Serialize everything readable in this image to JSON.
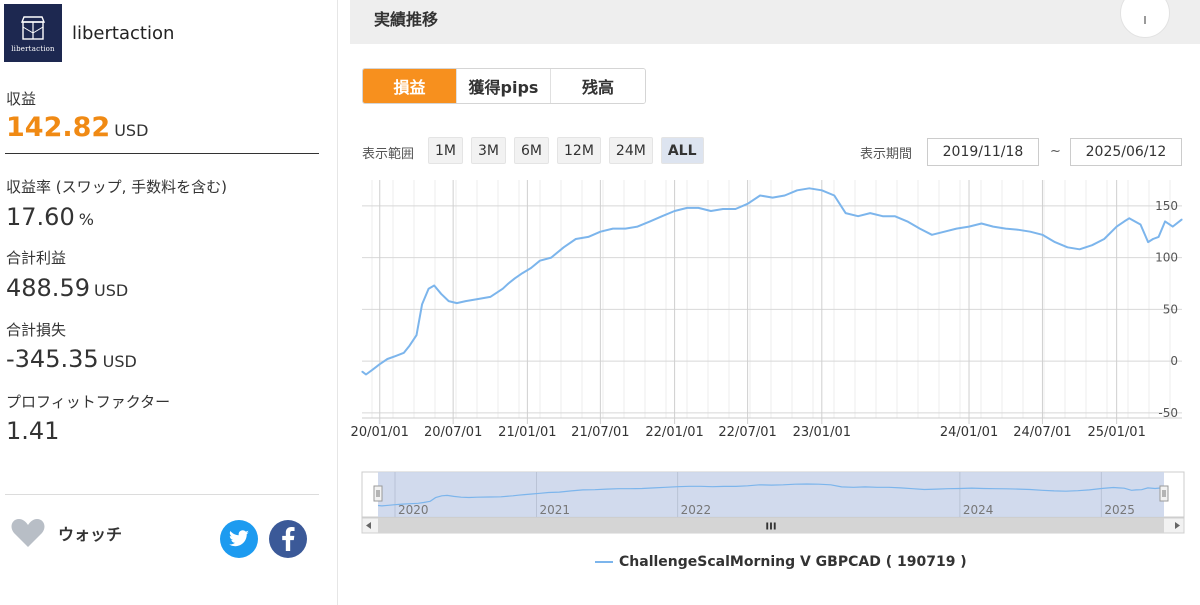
{
  "profile": {
    "name": "libertaction",
    "logo_caption": "libertaction"
  },
  "stats": {
    "profit_label": "収益",
    "profit_value": "142.82",
    "profit_unit": "USD",
    "rate_label": "収益率 (スワップ, 手数料を含む)",
    "rate_value": "17.60",
    "rate_unit": "%",
    "gross_profit_label": "合計利益",
    "gross_profit_value": "488.59",
    "gross_profit_unit": "USD",
    "gross_loss_label": "合計損失",
    "gross_loss_value": "-345.35",
    "gross_loss_unit": "USD",
    "pf_label": "プロフィットファクター",
    "pf_value": "1.41"
  },
  "watch": {
    "label": "ウォッチ"
  },
  "main": {
    "title": "実績推移",
    "tabs": [
      {
        "label": "損益",
        "active": true
      },
      {
        "label": "獲得pips",
        "active": false
      },
      {
        "label": "残高",
        "active": false
      }
    ],
    "range_label": "表示範囲",
    "range_buttons": [
      "1M",
      "3M",
      "6M",
      "12M",
      "24M",
      "ALL"
    ],
    "range_active": "ALL",
    "period_label": "表示期間",
    "date_from": "2019/11/18",
    "date_sep": "~",
    "date_to": "2025/06/12",
    "navigator_handle": "III"
  },
  "colors": {
    "accent": "#f7901e",
    "line": "#7cb5ec",
    "profit": "#f08a14"
  },
  "icons": {
    "download": "arrow-down-icon",
    "watch": "heart-icon",
    "twitter": "twitter-icon",
    "facebook": "facebook-icon"
  },
  "chart_data": {
    "type": "line",
    "series": [
      {
        "name": "ChallengeScalMorning V GBPCAD ( 190719 )",
        "x": [
          "2019-11-18",
          "2019-11-28",
          "2019-12-15",
          "2020-01-01",
          "2020-01-20",
          "2020-02-10",
          "2020-03-01",
          "2020-03-15",
          "2020-04-01",
          "2020-04-15",
          "2020-05-01",
          "2020-05-15",
          "2020-06-01",
          "2020-06-20",
          "2020-07-10",
          "2020-08-01",
          "2020-09-01",
          "2020-10-01",
          "2020-11-01",
          "2020-11-15",
          "2020-12-01",
          "2020-12-20",
          "2021-01-10",
          "2021-02-01",
          "2021-03-01",
          "2021-04-01",
          "2021-05-01",
          "2021-06-01",
          "2021-07-01",
          "2021-08-01",
          "2021-09-01",
          "2021-10-01",
          "2021-11-01",
          "2021-12-01",
          "2022-01-01",
          "2022-02-01",
          "2022-03-01",
          "2022-04-01",
          "2022-05-01",
          "2022-06-01",
          "2022-07-01",
          "2022-08-01",
          "2022-09-01",
          "2022-10-01",
          "2022-11-01",
          "2022-12-01",
          "2023-01-01",
          "2023-02-01",
          "2023-03-01",
          "2023-04-01",
          "2023-05-01",
          "2023-06-01",
          "2023-07-01",
          "2023-08-01",
          "2023-09-01",
          "2023-10-01",
          "2023-11-01",
          "2023-12-01",
          "2024-01-01",
          "2024-02-01",
          "2024-03-01",
          "2024-04-01",
          "2024-05-01",
          "2024-06-01",
          "2024-07-01",
          "2024-08-01",
          "2024-09-01",
          "2024-10-01",
          "2024-11-01",
          "2024-12-01",
          "2025-01-01",
          "2025-01-20",
          "2025-02-01",
          "2025-02-15",
          "2025-03-01",
          "2025-03-20",
          "2025-04-01",
          "2025-04-15",
          "2025-05-01",
          "2025-05-20",
          "2025-06-12"
        ],
        "y": [
          -10,
          -13,
          -8,
          -3,
          2,
          5,
          8,
          15,
          25,
          55,
          70,
          73,
          65,
          58,
          56,
          58,
          60,
          62,
          70,
          75,
          80,
          85,
          90,
          97,
          100,
          110,
          118,
          120,
          125,
          128,
          128,
          130,
          135,
          140,
          145,
          148,
          148,
          145,
          147,
          147,
          152,
          160,
          158,
          160,
          165,
          167,
          165,
          160,
          143,
          140,
          143,
          140,
          140,
          135,
          128,
          122,
          125,
          128,
          130,
          133,
          130,
          128,
          127,
          125,
          122,
          115,
          110,
          108,
          112,
          118,
          130,
          135,
          138,
          135,
          132,
          115,
          118,
          120,
          135,
          130,
          137
        ]
      }
    ],
    "x_ticks": [
      "20/01/01",
      "20/07/01",
      "21/01/01",
      "21/07/01",
      "22/01/01",
      "22/07/01",
      "23/01/01",
      "24/01/01",
      "24/07/01",
      "25/01/01"
    ],
    "y_ticks": [
      -50,
      0,
      50,
      100,
      150
    ],
    "ylim": [
      -55,
      175
    ],
    "xlim": [
      "2019-11-18",
      "2025-06-12"
    ],
    "navigator_labels": [
      "2020",
      "2021",
      "2022",
      "2024",
      "2025"
    ],
    "grid": true,
    "legend_position": "bottom-center"
  }
}
